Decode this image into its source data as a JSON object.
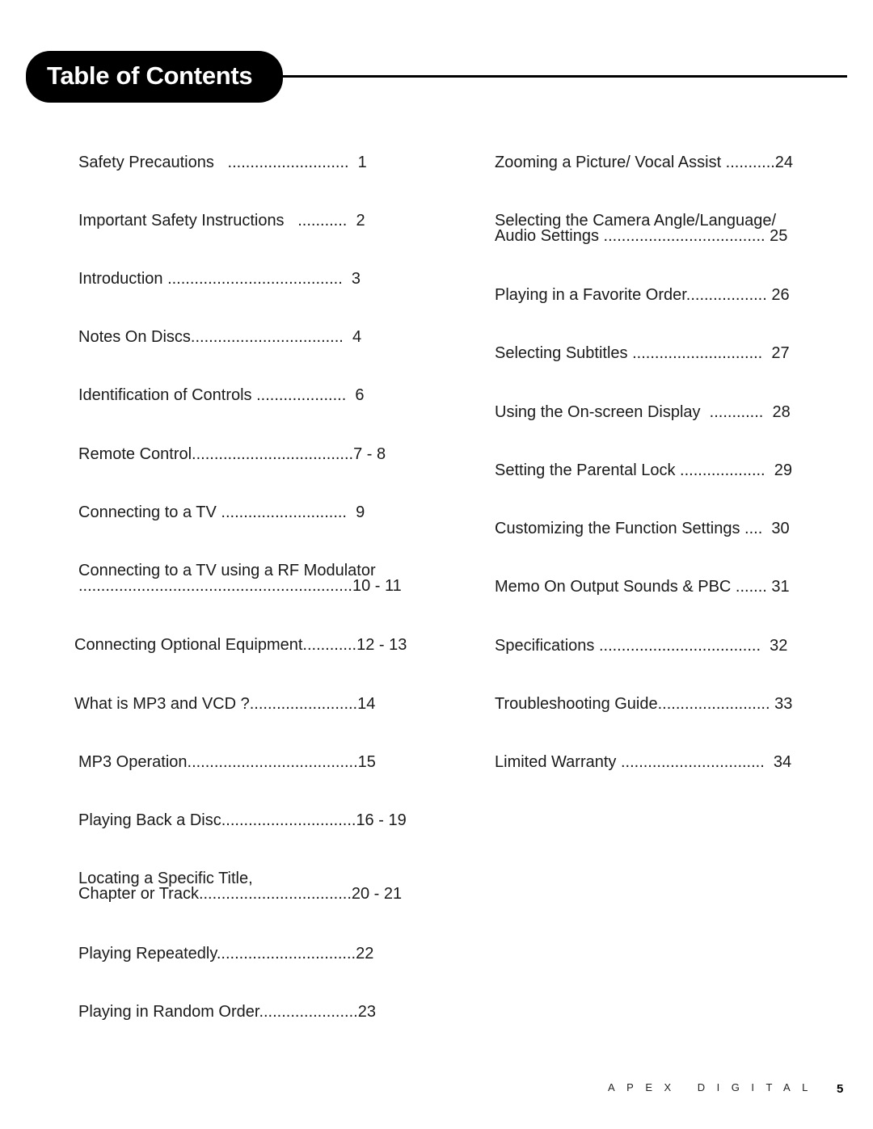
{
  "header": {
    "title": "Table of Contents"
  },
  "left_column": [
    {
      "lines": [
        "Safety Precautions   ...........................  1"
      ],
      "label": "Safety Precautions",
      "page": "1"
    },
    {
      "lines": [
        "Important Safety Instructions   ...........  2"
      ],
      "label": "Important Safety Instructions",
      "page": "2"
    },
    {
      "lines": [
        "Introduction .......................................  3"
      ],
      "label": "Introduction",
      "page": "3"
    },
    {
      "lines": [
        "Notes On Discs..................................  4"
      ],
      "label": "Notes On Discs",
      "page": "4"
    },
    {
      "lines": [
        "Identification of Controls ....................  6"
      ],
      "label": "Identification of Controls",
      "page": "6"
    },
    {
      "lines": [
        "Remote Control....................................7 - 8"
      ],
      "label": "Remote Control",
      "page": "7 - 8"
    },
    {
      "lines": [
        "Connecting to a TV ............................  9"
      ],
      "label": "Connecting to a TV",
      "page": "9"
    },
    {
      "lines": [
        "Connecting to a TV using a RF Modulator",
        ".............................................................10 - 11"
      ],
      "label": "Connecting to a TV using a RF Modulator",
      "page": "10 - 11"
    },
    {
      "lines": [
        "Connecting Optional Equipment............12 - 13"
      ],
      "label": "Connecting Optional Equipment",
      "page": "12 - 13"
    },
    {
      "lines": [
        "What is MP3 and VCD ?........................14"
      ],
      "label": "What is MP3 and VCD ?",
      "page": "14"
    },
    {
      "lines": [
        "MP3 Operation......................................15"
      ],
      "label": "MP3 Operation",
      "page": "15"
    },
    {
      "lines": [
        "Playing Back a Disc..............................16 - 19"
      ],
      "label": "Playing Back a Disc",
      "page": "16 - 19"
    },
    {
      "lines": [
        "Locating a Specific Title,",
        "Chapter or Track..................................20 - 21"
      ],
      "label": "Locating a Specific Title, Chapter or Track",
      "page": "20 - 21"
    },
    {
      "lines": [
        "Playing Repeatedly...............................22"
      ],
      "label": "Playing Repeatedly",
      "page": "22"
    },
    {
      "lines": [
        "Playing in Random Order......................23"
      ],
      "label": "Playing in Random Order",
      "page": "23"
    }
  ],
  "right_column": [
    {
      "lines": [
        "Zooming a Picture/ Vocal Assist ...........24"
      ],
      "label": "Zooming a Picture/ Vocal Assist",
      "page": "24"
    },
    {
      "lines": [
        "Selecting the Camera Angle/Language/",
        "Audio Settings .................................... 25"
      ],
      "label": "Selecting the Camera Angle/Language/Audio Settings",
      "page": "25"
    },
    {
      "lines": [
        "Playing in a Favorite Order.................. 26"
      ],
      "label": "Playing in a Favorite Order",
      "page": "26"
    },
    {
      "lines": [
        "Selecting Subtitles .............................  27"
      ],
      "label": "Selecting Subtitles",
      "page": "27"
    },
    {
      "lines": [
        "Using the On-screen Display  ............  28"
      ],
      "label": "Using the On-screen Display",
      "page": "28"
    },
    {
      "lines": [
        "Setting the Parental Lock ...................  29"
      ],
      "label": "Setting the Parental Lock",
      "page": "29"
    },
    {
      "lines": [
        "Customizing the Function Settings ....  30"
      ],
      "label": "Customizing the Function Settings",
      "page": "30"
    },
    {
      "lines": [
        "Memo On Output Sounds & PBC ....... 31"
      ],
      "label": "Memo On Output Sounds & PBC",
      "page": "31"
    },
    {
      "lines": [
        "Specifications ....................................  32"
      ],
      "label": "Specifications",
      "page": "32"
    },
    {
      "lines": [
        "Troubleshooting Guide......................... 33"
      ],
      "label": "Troubleshooting Guide",
      "page": "33"
    },
    {
      "lines": [
        "Limited Warranty ................................  34"
      ],
      "label": "Limited Warranty",
      "page": "34"
    }
  ],
  "footer": {
    "brand": "APEX DIGITAL",
    "page_number": "5"
  }
}
